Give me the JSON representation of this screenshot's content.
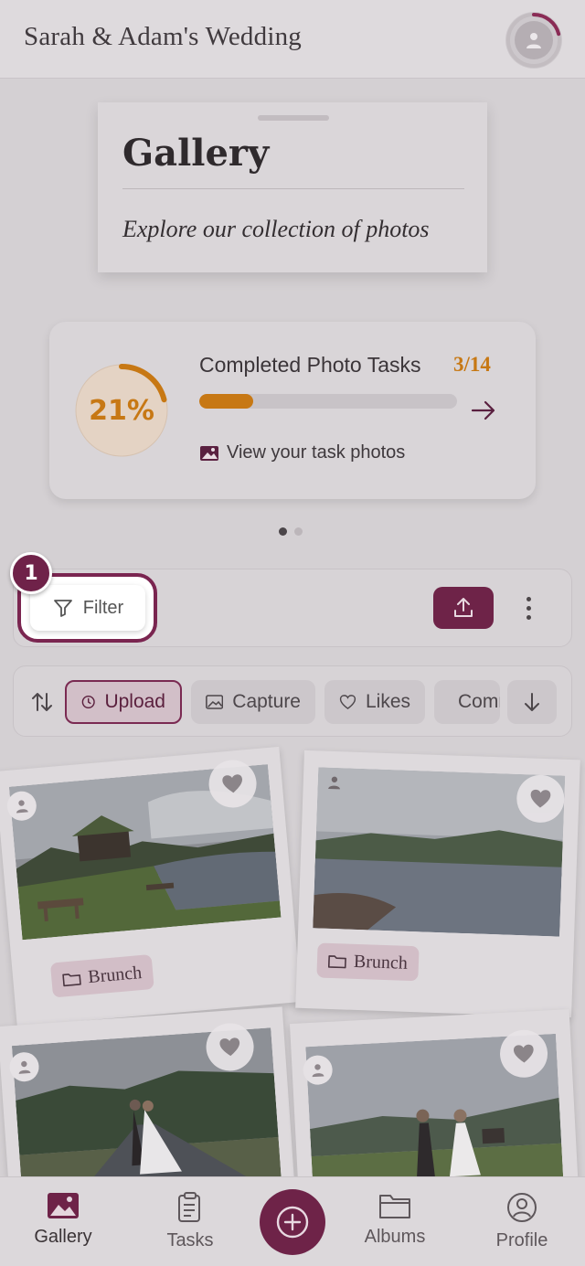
{
  "header": {
    "title": "Sarah & Adam's Wedding",
    "progress_ring_fraction": 0.21
  },
  "title_card": {
    "title": "Gallery",
    "subtitle": "Explore our collection of photos"
  },
  "progress": {
    "percent_label": "21%",
    "fraction": 0.21,
    "task_title": "Completed Photo Tasks",
    "count": "3/14",
    "view_link": "View your task photos",
    "carousel_dots": 2,
    "active_dot": 0
  },
  "toolbar": {
    "filter_label": "Filter",
    "step_badge": "1"
  },
  "sort_chips": [
    {
      "label": "Upload",
      "icon": "clock-icon",
      "selected": true
    },
    {
      "label": "Capture",
      "icon": "image-icon",
      "selected": false
    },
    {
      "label": "Likes",
      "icon": "heart-outline-icon",
      "selected": false
    },
    {
      "label": "Comments",
      "icon": "comment-icon",
      "selected": false
    }
  ],
  "photos": [
    {
      "tag": "Brunch",
      "scene": "cabin by lake"
    },
    {
      "tag": "Brunch",
      "scene": "mountain lake"
    },
    {
      "tag": "",
      "scene": "couple on road"
    },
    {
      "tag": "",
      "scene": "couple walking"
    }
  ],
  "nav": {
    "items": [
      {
        "label": "Gallery",
        "icon": "gallery-icon",
        "active": true
      },
      {
        "label": "Tasks",
        "icon": "clipboard-icon",
        "active": false
      },
      {
        "label": "Albums",
        "icon": "folder-icon",
        "active": false
      },
      {
        "label": "Profile",
        "icon": "profile-icon",
        "active": false
      }
    ],
    "fab_icon": "plus-circle-icon"
  },
  "colors": {
    "accent": "#6e2348",
    "progress": "#c77814",
    "background": "#d4d0d3"
  }
}
